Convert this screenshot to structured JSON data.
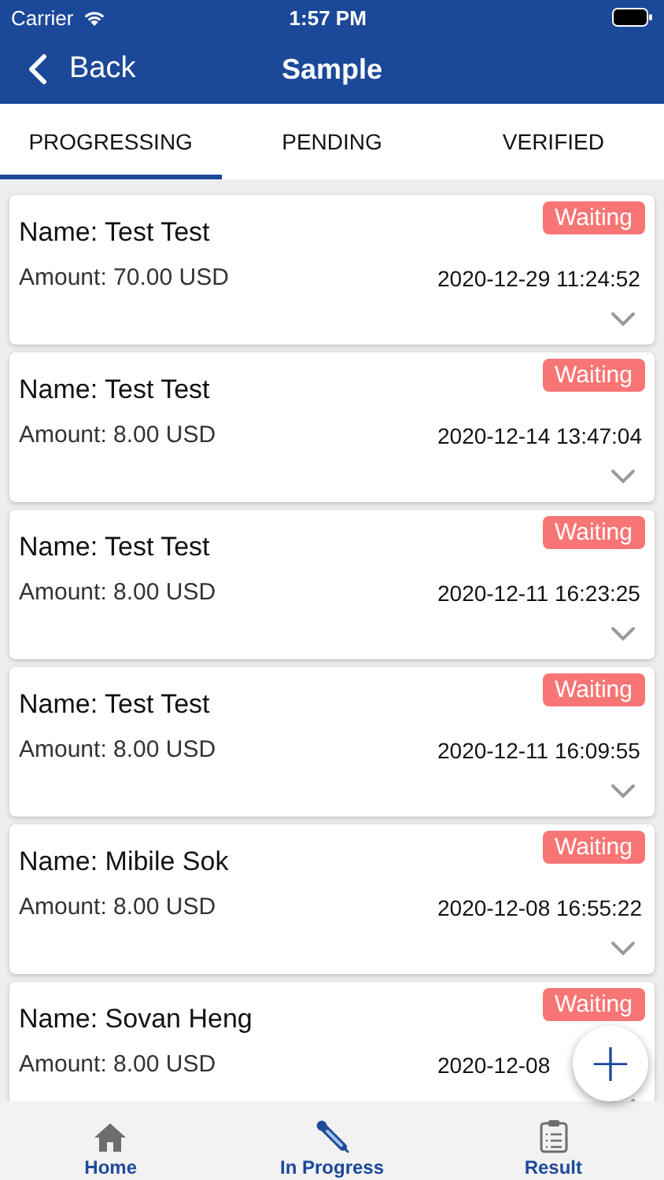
{
  "status_bar": {
    "carrier": "Carrier",
    "time": "1:57 PM"
  },
  "nav": {
    "back": "Back",
    "title": "Sample"
  },
  "tabs": [
    {
      "label": "PROGRESSING",
      "selected": true
    },
    {
      "label": "PENDING",
      "selected": false
    },
    {
      "label": "VERIFIED",
      "selected": false
    }
  ],
  "records": [
    {
      "name": "Name: Test Test",
      "amount": "Amount: 70.00 USD",
      "datetime": "2020-12-29 11:24:52",
      "status": "Waiting"
    },
    {
      "name": "Name: Test Test",
      "amount": "Amount: 8.00 USD",
      "datetime": "2020-12-14 13:47:04",
      "status": "Waiting"
    },
    {
      "name": "Name: Test Test",
      "amount": "Amount: 8.00 USD",
      "datetime": "2020-12-11 16:23:25",
      "status": "Waiting"
    },
    {
      "name": "Name: Test Test",
      "amount": "Amount: 8.00 USD",
      "datetime": "2020-12-11 16:09:55",
      "status": "Waiting"
    },
    {
      "name": "Name: Mibile Sok",
      "amount": "Amount: 8.00 USD",
      "datetime": "2020-12-08 16:55:22",
      "status": "Waiting"
    },
    {
      "name": "Name: Sovan Heng",
      "amount": "Amount: 8.00 USD",
      "datetime": "2020-12-08",
      "status": "Waiting"
    }
  ],
  "fab": "+",
  "tab_bar": [
    {
      "kind": "home",
      "label": "Home",
      "selected": false
    },
    {
      "kind": "progress",
      "label": "In Progress",
      "selected": true
    },
    {
      "kind": "result",
      "label": "Result",
      "selected": false
    }
  ]
}
